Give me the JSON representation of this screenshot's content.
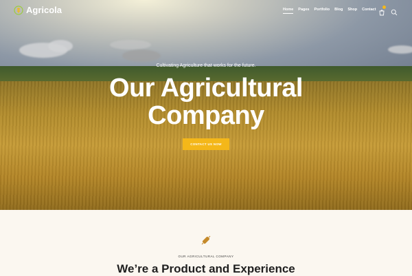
{
  "brand": {
    "name": "Agricola",
    "logo_icon": "wheat-leaf-logo-icon",
    "accent": "#f4b719"
  },
  "nav": {
    "items": [
      {
        "label": "Home",
        "active": true
      },
      {
        "label": "Pages",
        "active": false
      },
      {
        "label": "Portfolio",
        "active": false
      },
      {
        "label": "Blog",
        "active": false
      },
      {
        "label": "Shop",
        "active": false
      },
      {
        "label": "Contact",
        "active": false
      }
    ],
    "icons": [
      "cart-icon",
      "search-icon"
    ]
  },
  "hero": {
    "tagline": "Cultivating Agriculture that works for the future.",
    "headline_line1": "Our Agricultural",
    "headline_line2": "Company",
    "cta_label": "CONTACT US NOW"
  },
  "about": {
    "icon": "wheat-icon",
    "eyebrow": "OUR AGRICULTURAL COMPANY",
    "title": "We’re a Product and Experience"
  }
}
